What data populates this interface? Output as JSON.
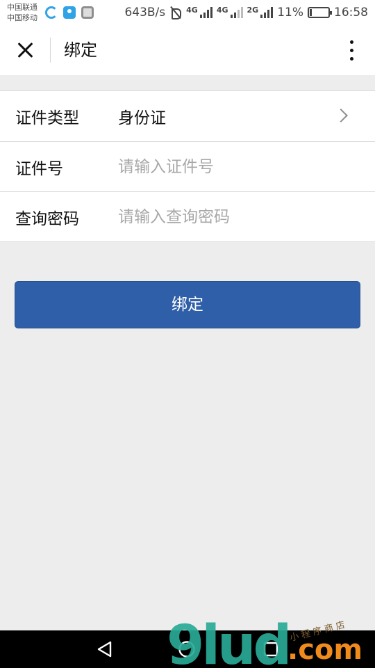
{
  "status_bar": {
    "carrier_1": "中国联通",
    "carrier_2": "中国移动",
    "speed": "643B/s",
    "network_1": "4G",
    "network_2": "4G",
    "network_3": "2G",
    "battery_text": "11%",
    "battery_level": 0.11,
    "time": "16:58",
    "icons": [
      "circle-app-icon",
      "location-app-icon",
      "gallery-icon",
      "mute-icon",
      "signal-icon",
      "battery-icon"
    ]
  },
  "header": {
    "title": "绑定",
    "close_icon": "close-icon",
    "more_icon": "more-vertical-icon"
  },
  "form": {
    "rows": [
      {
        "label": "证件类型",
        "value": "身份证",
        "type": "select"
      },
      {
        "label": "证件号",
        "placeholder": "请输入证件号",
        "type": "input"
      },
      {
        "label": "查询密码",
        "placeholder": "请输入查询密码",
        "type": "input"
      }
    ]
  },
  "actions": {
    "bind_label": "绑定",
    "accent": "#2f5fa8"
  },
  "nav": {
    "back_icon": "back-triangle-icon",
    "home_icon": "home-circle-icon",
    "recent_icon": "recent-square-icon"
  },
  "watermark": {
    "logo": "9lud",
    "com": ".com",
    "small": "小程序商店"
  }
}
